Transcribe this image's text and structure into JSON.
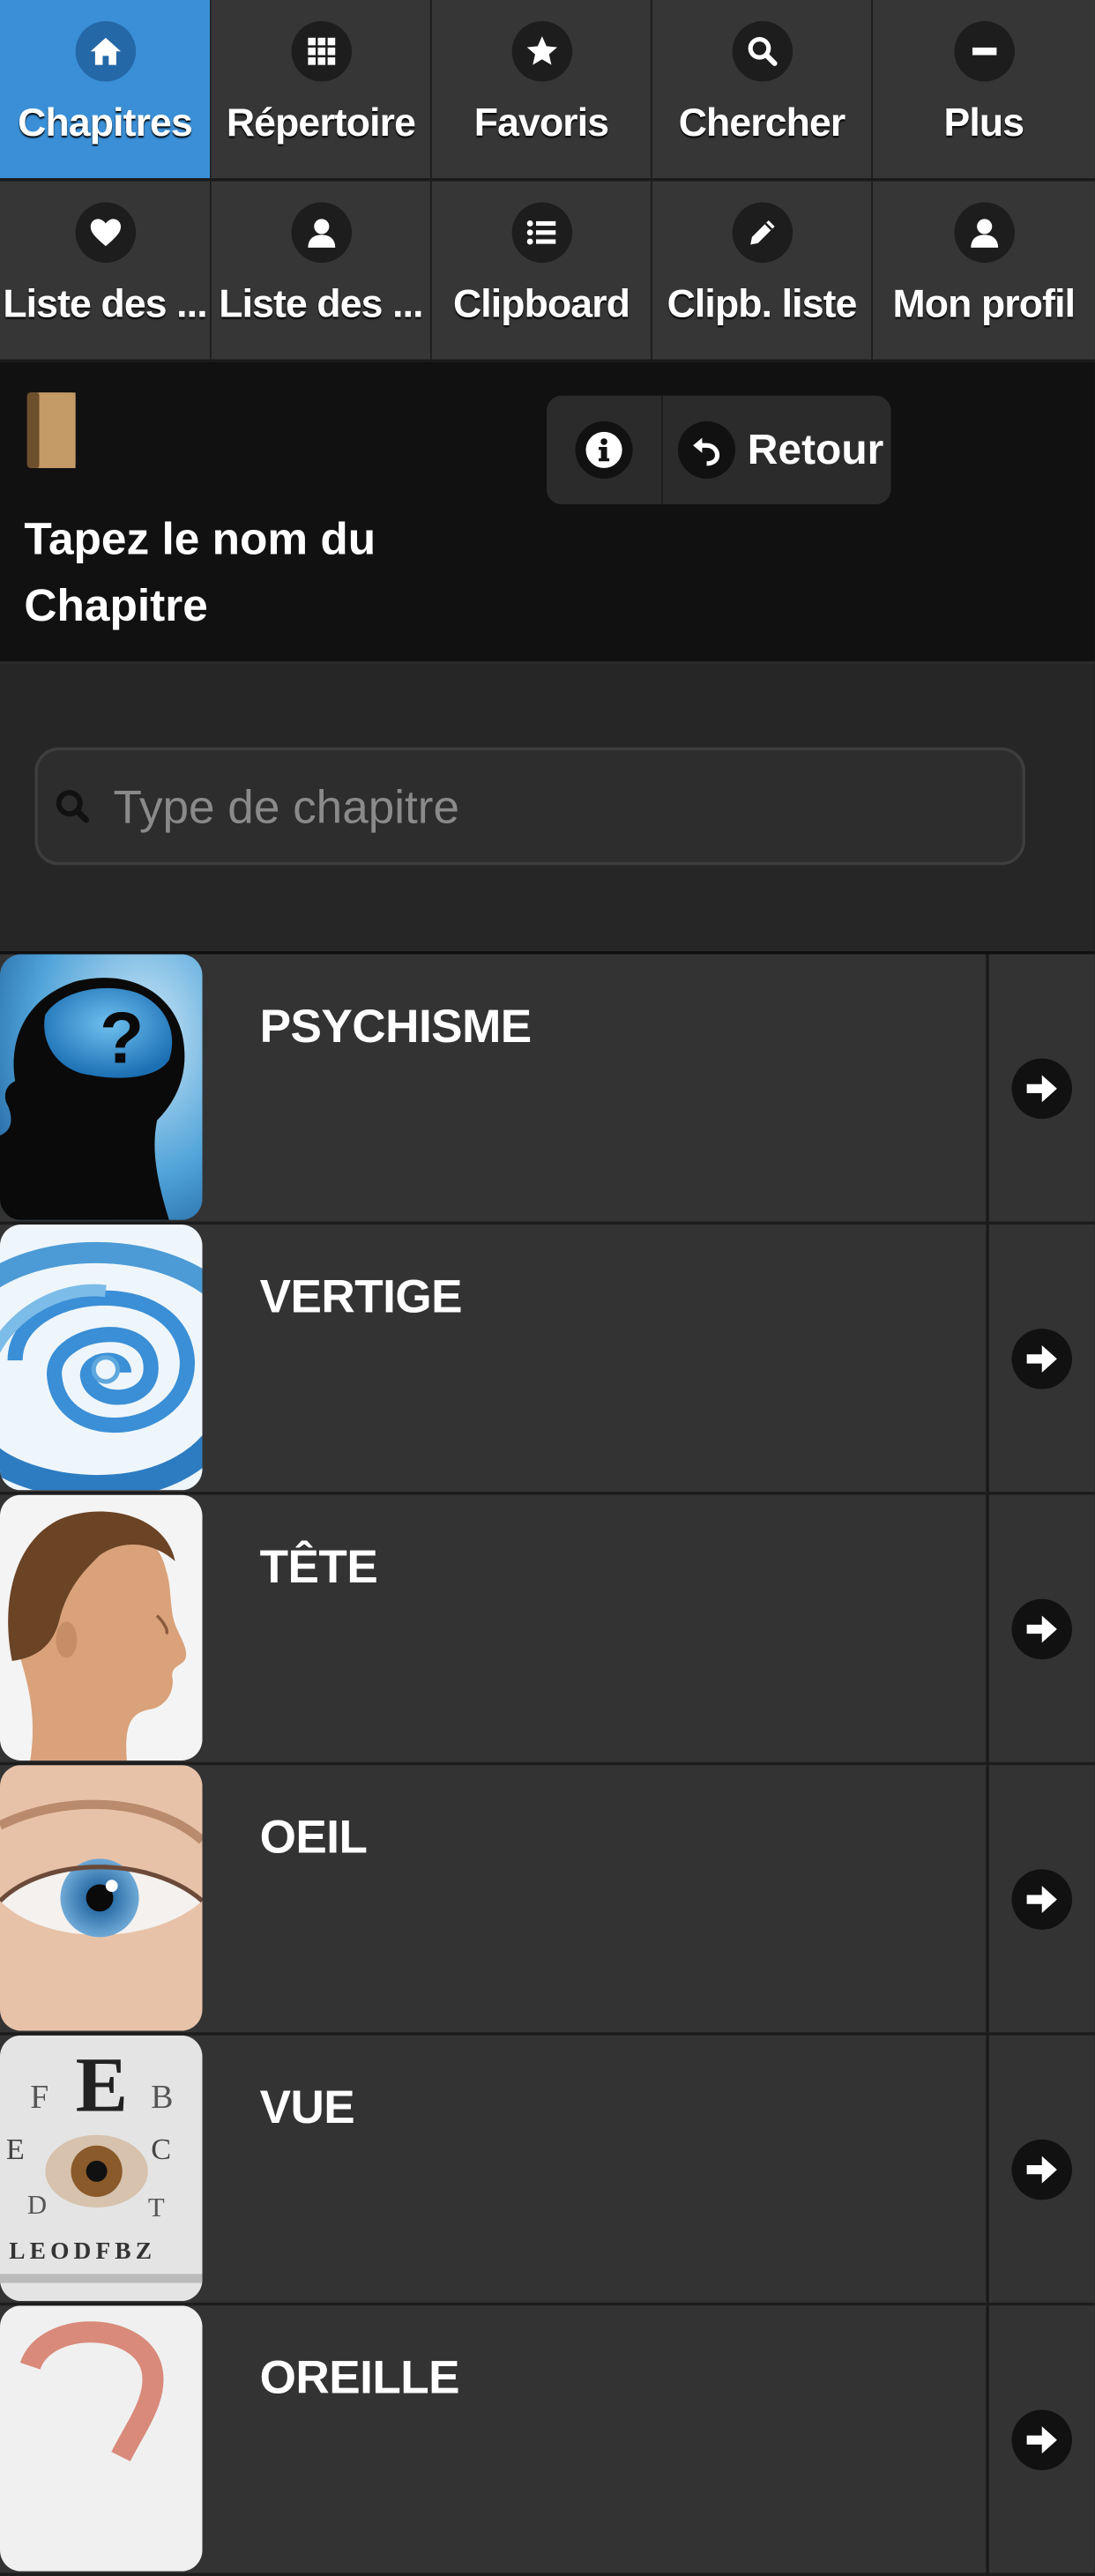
{
  "nav": [
    {
      "label": "Chapitres",
      "icon": "home-icon",
      "active": true
    },
    {
      "label": "Répertoire",
      "icon": "grid-icon",
      "active": false
    },
    {
      "label": "Favoris",
      "icon": "star-icon",
      "active": false
    },
    {
      "label": "Chercher",
      "icon": "search-icon",
      "active": false
    },
    {
      "label": "Plus",
      "icon": "minus-icon",
      "active": false
    },
    {
      "label": "Liste des ...",
      "icon": "heart-icon",
      "active": false
    },
    {
      "label": "Liste des ...",
      "icon": "user-icon",
      "active": false
    },
    {
      "label": "Clipboard",
      "icon": "list-icon",
      "active": false
    },
    {
      "label": "Clipb. liste",
      "icon": "pencil-icon",
      "active": false
    },
    {
      "label": "Mon profil",
      "icon": "user-icon",
      "active": false
    }
  ],
  "header": {
    "title": "Tapez le nom du Chapitre",
    "back_label": "Retour"
  },
  "search": {
    "placeholder": "Type de chapitre",
    "value": ""
  },
  "chapters": [
    {
      "title": "PSYCHISME",
      "image": "head-question"
    },
    {
      "title": "VERTIGE",
      "image": "spiral"
    },
    {
      "title": "TÊTE",
      "image": "head-profile"
    },
    {
      "title": "OEIL",
      "image": "eye"
    },
    {
      "title": "VUE",
      "image": "eye-chart"
    },
    {
      "title": "OREILLE",
      "image": "ear"
    }
  ],
  "colors": {
    "active": "#3a8fd6",
    "cell": "#363636",
    "header": "#111111"
  }
}
